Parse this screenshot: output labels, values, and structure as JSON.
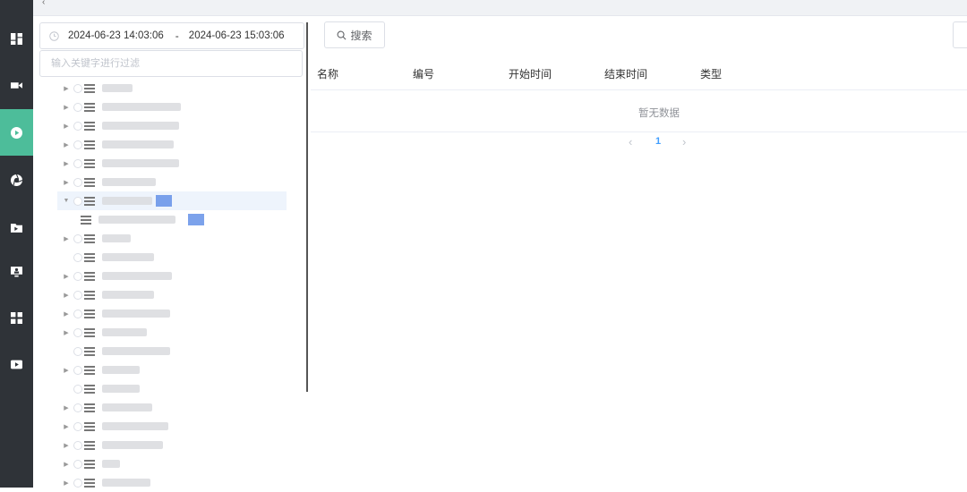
{
  "date_range": {
    "start": "2024-06-23 14:03:06",
    "separator": "-",
    "end": "2024-06-23 15:03:06"
  },
  "filter": {
    "placeholder": "输入关键字进行过滤"
  },
  "search_button": {
    "label": "搜索"
  },
  "table": {
    "columns": [
      "名称",
      "编号",
      "开始时间",
      "结束时间",
      "类型"
    ],
    "empty_text": "暂无数据"
  },
  "pagination": {
    "prev": "‹",
    "current": "1",
    "next": "›"
  },
  "sidebar": {
    "items": [
      {
        "icon": "dashboard-icon",
        "active": false
      },
      {
        "icon": "video-camera-icon",
        "active": false
      },
      {
        "icon": "playback-icon",
        "active": true
      },
      {
        "icon": "aperture-icon",
        "active": false
      },
      {
        "icon": "folder-import-icon",
        "active": false
      },
      {
        "icon": "monitor-user-icon",
        "active": false
      },
      {
        "icon": "apps-grid-icon",
        "active": false
      },
      {
        "icon": "video-play-icon",
        "active": false
      }
    ],
    "active_color": "#4dbd9a",
    "background": "#2f3338"
  },
  "accent_color": "#409eff"
}
